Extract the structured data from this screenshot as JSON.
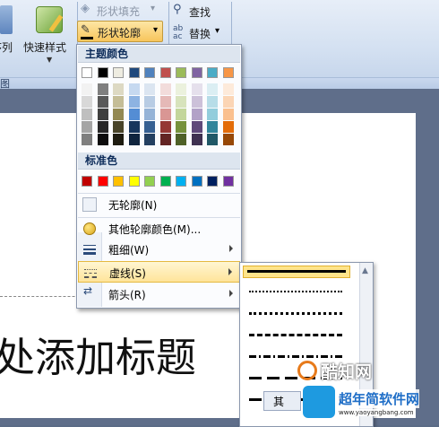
{
  "ribbon": {
    "arrange_fragment": "序列",
    "quick_styles": "快速样式",
    "shape_fill": "形状填充",
    "shape_fill_arrow": "▾",
    "shape_outline": "形状轮廓",
    "shape_outline_arrow": "▾",
    "find": "查找",
    "replace": "替换",
    "replace_arrow": "▾",
    "group_label_fragment": "图"
  },
  "menu": {
    "theme_colors_header": "主题颜色",
    "standard_colors_header": "标准色",
    "theme_top_row": [
      "#ffffff",
      "#000000",
      "#eeece1",
      "#1f497d",
      "#4f81bd",
      "#c0504d",
      "#9bbb59",
      "#8064a2",
      "#4bacc6",
      "#f79646"
    ],
    "theme_shade_rows": [
      [
        "#f2f2f2",
        "#7f7f7f",
        "#ddd9c3",
        "#c6d9f0",
        "#dbe5f1",
        "#f2dcdb",
        "#ebf1dd",
        "#e5e0ec",
        "#dbeef3",
        "#fdeada"
      ],
      [
        "#d8d8d8",
        "#595959",
        "#c4bd97",
        "#8db3e2",
        "#b8cce4",
        "#e5b9b7",
        "#d7e3bc",
        "#ccc1d9",
        "#b7dde8",
        "#fbd5b5"
      ],
      [
        "#bfbfbf",
        "#3f3f3f",
        "#938953",
        "#548dd4",
        "#95b3d7",
        "#d99694",
        "#c3d69b",
        "#b2a2c7",
        "#92cddc",
        "#fac08f"
      ],
      [
        "#a5a5a5",
        "#262626",
        "#494429",
        "#17365d",
        "#366092",
        "#953734",
        "#76923c",
        "#5f497a",
        "#31859b",
        "#e36c09"
      ],
      [
        "#7f7f7f",
        "#0c0c0c",
        "#1d1b10",
        "#0f243e",
        "#244061",
        "#632423",
        "#4f6128",
        "#3f3151",
        "#205867",
        "#974806"
      ]
    ],
    "standard_colors": [
      "#c00000",
      "#ff0000",
      "#ffc000",
      "#ffff00",
      "#92d050",
      "#00b050",
      "#00b0f0",
      "#0070c0",
      "#002060",
      "#7030a0"
    ],
    "items": [
      {
        "label": "无轮廓(N)",
        "icon": "no-outline-icon"
      },
      {
        "label": "其他轮廓颜色(M)...",
        "icon": "palette-icon"
      },
      {
        "label": "粗细(W)",
        "icon": "line-weight-icon"
      },
      {
        "label": "虚线(S)",
        "icon": "dash-icon"
      },
      {
        "label": "箭头(R)",
        "icon": "arrow-icon"
      }
    ]
  },
  "dash_styles": [
    "solid",
    "round-dot",
    "square-dot",
    "dash",
    "dash-dot",
    "long-dash",
    "long-dash-dot"
  ],
  "slide": {
    "title": "处添加标题"
  },
  "watermark": {
    "brand": "酷知网",
    "brand2": "超年简软件网",
    "url": "www.yaoyangbang.com"
  },
  "bottom_fragment": "其"
}
